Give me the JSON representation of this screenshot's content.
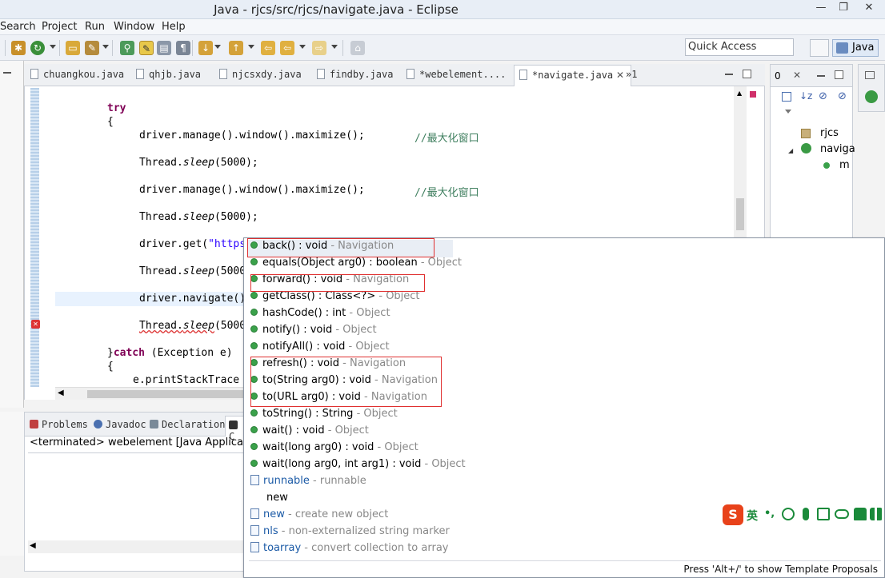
{
  "window": {
    "title": "Java - rjcs/src/rjcs/navigate.java - Eclipse",
    "min_glyph": "—",
    "max_glyph": "❐",
    "close_glyph": "✕"
  },
  "menubar": [
    "Search",
    "Project",
    "Run",
    "Window",
    "Help"
  ],
  "quick_access": {
    "placeholder": "Quick Access"
  },
  "perspective": {
    "label": "Java"
  },
  "editor_tabs": [
    {
      "label": "chuangkou.java"
    },
    {
      "label": "qhjb.java"
    },
    {
      "label": "njcsxdy.java"
    },
    {
      "label": "findby.java"
    },
    {
      "label": "*webelement...."
    },
    {
      "label": "*navigate.java",
      "active": true
    }
  ],
  "tab_overflow": "»1",
  "code": {
    "l1_kw": "try",
    "l2": "{",
    "l3_code": "driver.manage().window().maximize();",
    "l3_comment": "//最大化窗口",
    "l4_pre": "Thread.",
    "l4_method": "sleep",
    "l4_post": "(5000);",
    "l5_code": "driver.manage().window().maximize();",
    "l5_comment": "//最大化窗口",
    "l6_pre": "Thread.",
    "l6_method": "sleep",
    "l6_post": "(5000);",
    "l7_pre": "driver.get(",
    "l7_str": "\"https:",
    "l8_pre": "Thread.",
    "l8_method": "sleep",
    "l8_post": "(5000",
    "l9": "driver.navigate().",
    "l10_pre": "Thread.",
    "l10_method": "sleep",
    "l10_post": "(5000",
    "l11_brace": "}",
    "l11_kw": "catch",
    "l11_rest": " (Exception e)",
    "l12": "{",
    "l13": "e.printStackTrace"
  },
  "outline": {
    "tab_label": "0",
    "items": [
      {
        "label": "rjcs"
      },
      {
        "label": "naviga"
      },
      {
        "label": "m"
      }
    ]
  },
  "bottom_tabs": [
    {
      "label": "Problems",
      "color": "#c04040"
    },
    {
      "label": "Javadoc",
      "color": "#4a70b0"
    },
    {
      "label": "Declaration",
      "color": "#7a8a99"
    },
    {
      "label": "C",
      "color": "#333333"
    }
  ],
  "console_text": "<terminated> webelement [Java Application] C",
  "proposals": [
    {
      "name": "back() : void",
      "decl": " - Navigation",
      "kind": "method"
    },
    {
      "name": "equals(Object arg0) : boolean",
      "decl": " - Object",
      "kind": "method"
    },
    {
      "name": "forward() : void",
      "decl": " - Navigation",
      "kind": "method"
    },
    {
      "name": "getClass() : Class<?>",
      "decl": " - Object",
      "kind": "method"
    },
    {
      "name": "hashCode() : int",
      "decl": " - Object",
      "kind": "method"
    },
    {
      "name": "notify() : void",
      "decl": " - Object",
      "kind": "method"
    },
    {
      "name": "notifyAll() : void",
      "decl": " - Object",
      "kind": "method"
    },
    {
      "name": "refresh() : void",
      "decl": " - Navigation",
      "kind": "method"
    },
    {
      "name": "to(String arg0) : void",
      "decl": " - Navigation",
      "kind": "method"
    },
    {
      "name": "to(URL arg0) : void",
      "decl": " - Navigation",
      "kind": "method"
    },
    {
      "name": "toString() : String",
      "decl": " - Object",
      "kind": "method"
    },
    {
      "name": "wait() : void",
      "decl": " - Object",
      "kind": "method"
    },
    {
      "name": "wait(long arg0) : void",
      "decl": " - Object",
      "kind": "method"
    },
    {
      "name": "wait(long arg0, int arg1) : void",
      "decl": " - Object",
      "kind": "method"
    },
    {
      "name": "runnable",
      "decl": " - runnable",
      "kind": "template"
    },
    {
      "name": "new",
      "decl": "",
      "kind": "plain"
    },
    {
      "name": "new",
      "decl": " - create new object",
      "kind": "template"
    },
    {
      "name": "nls",
      "decl": " - non-externalized string marker",
      "kind": "template"
    },
    {
      "name": "toarray",
      "decl": " - convert collection to array",
      "kind": "template"
    }
  ],
  "popup_footer": "Press 'Alt+/' to show Template Proposals",
  "ime": {
    "label": "英"
  },
  "colors": {
    "method_dot": "#3aa14a",
    "highlight_box": "#e03030",
    "keyword": "#7f0055",
    "comment": "#3f7f5f"
  }
}
